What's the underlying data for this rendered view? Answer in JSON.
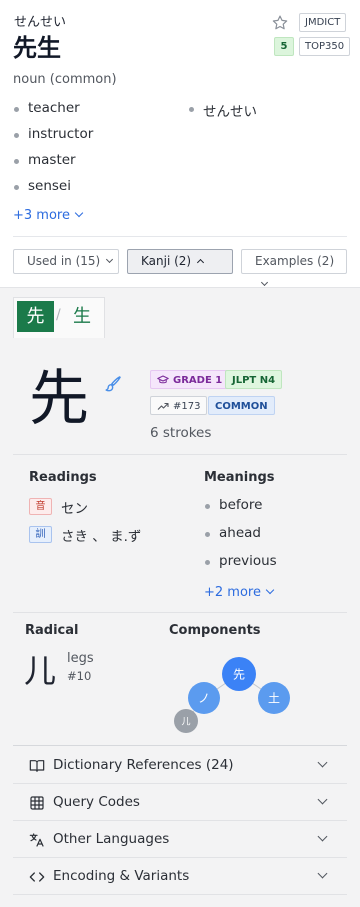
{
  "entry": {
    "reading": "せんせい",
    "headword": "先生",
    "badges": {
      "source": "JMDICT",
      "rank_num": "5",
      "rank_label": "TOP350"
    },
    "pos": "noun (common)",
    "glosses": [
      "teacher",
      "instructor",
      "master",
      "sensei"
    ],
    "alt_reading": "せんせい",
    "more_label": "+3 more"
  },
  "tabs": [
    {
      "label": "Used in (15)"
    },
    {
      "label": "Kanji (2)"
    },
    {
      "label": "Examples (2)"
    }
  ],
  "kanji_tabs": {
    "active": "先",
    "separator": "/",
    "other": "生"
  },
  "kanji": {
    "character": "先",
    "tags": {
      "grade": "GRADE 1",
      "jlpt": "JLPT N4",
      "freq": "#173",
      "common": "COMMON"
    },
    "strokes": "6 strokes",
    "readings_header": "Readings",
    "on_label": "音",
    "on_reading": "セン",
    "kun_label": "訓",
    "kun_reading": "さき 、 ま.ず",
    "meanings_header": "Meanings",
    "meanings": [
      "before",
      "ahead",
      "previous"
    ],
    "meanings_more": "+2 more",
    "radical_header": "Radical",
    "radical": {
      "glyph": "儿",
      "name": "legs",
      "number": "#10"
    },
    "components_header": "Components",
    "components": {
      "center": "先",
      "nodes": [
        "ノ",
        "土",
        "儿"
      ]
    }
  },
  "sections": [
    {
      "label": "Dictionary References (24)",
      "icon": "book-icon"
    },
    {
      "label": "Query Codes",
      "icon": "grid-icon"
    },
    {
      "label": "Other Languages",
      "icon": "translate-icon"
    },
    {
      "label": "Encoding & Variants",
      "icon": "code-icon"
    }
  ],
  "colors": {
    "accent_green": "#1b7a4a",
    "link_blue": "#2d6cdf",
    "node_blue": "#4a8fe8",
    "node_gray": "#9aa0a8"
  }
}
